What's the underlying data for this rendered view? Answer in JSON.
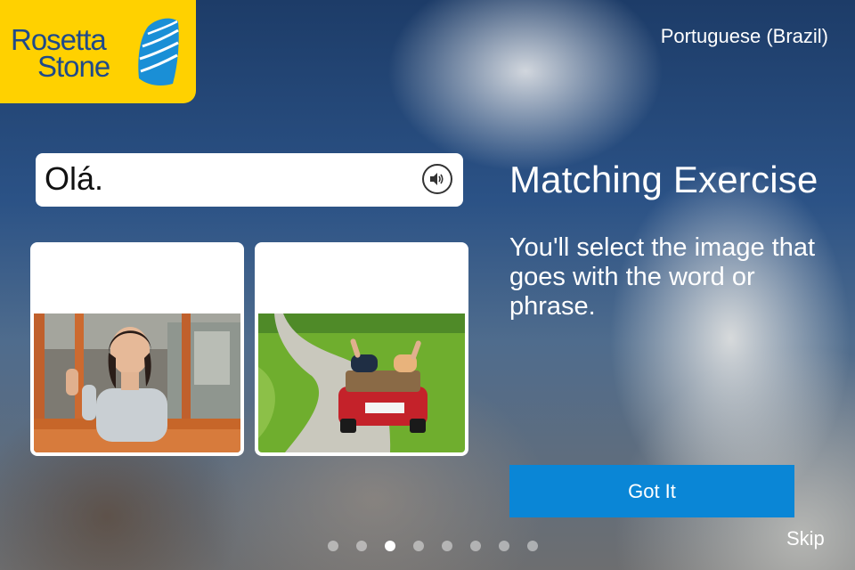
{
  "logo": {
    "line1": "Rosetta",
    "line2": "Stone"
  },
  "language": "Portuguese (Brazil)",
  "prompt": {
    "text": "Olá."
  },
  "lesson": {
    "title": "Matching Exercise",
    "description": "You'll select the image that goes with the word or phrase."
  },
  "buttons": {
    "got_it": "Got It",
    "skip": "Skip"
  },
  "pagination": {
    "total": 8,
    "active": 3
  },
  "colors": {
    "brand_yellow": "#ffd100",
    "brand_blue": "#1f4a8a",
    "button_blue": "#0a86d6"
  },
  "icons": {
    "audio": "speaker-icon"
  }
}
